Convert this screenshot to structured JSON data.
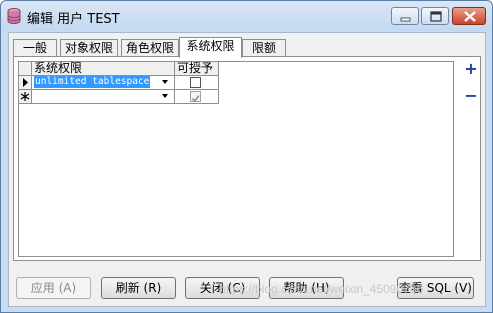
{
  "window": {
    "title": "编辑 用户 TEST"
  },
  "tabs": [
    {
      "label": "一般"
    },
    {
      "label": "对象权限"
    },
    {
      "label": "角色权限"
    },
    {
      "label": "系统权限"
    },
    {
      "label": "限额"
    }
  ],
  "active_tab": "系统权限",
  "grid": {
    "columns": [
      "系统权限",
      "可授予"
    ],
    "rows": [
      {
        "privilege": "unlimited tablespace",
        "grantable": false,
        "current": true
      },
      {
        "privilege": "",
        "grantable": true,
        "new_row": true
      }
    ],
    "indicators": {
      "current": "▶",
      "new": "✱"
    }
  },
  "side_buttons": {
    "add": "+",
    "remove": "−"
  },
  "buttons": {
    "apply": "应用 (A)",
    "refresh": "刷新 (R)",
    "close": "关闭 (C)",
    "help": "帮助 (H)",
    "view_sql": "查看 SQL (V)"
  },
  "watermark": "https://blog.csdn.net/weixin_45090736"
}
